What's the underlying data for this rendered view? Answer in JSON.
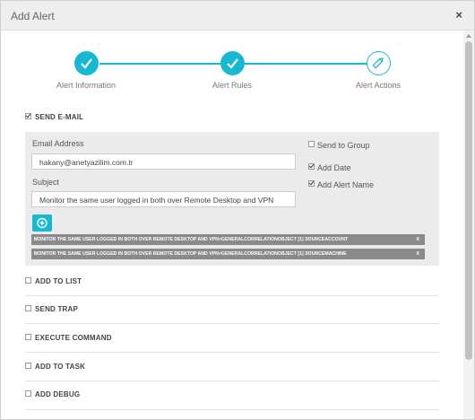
{
  "dialog": {
    "title": "Add Alert",
    "close_glyph": "×"
  },
  "wizard": {
    "steps": [
      {
        "label": "Alert Information",
        "state": "done",
        "icon": "check-icon"
      },
      {
        "label": "Alert Rules",
        "state": "done",
        "icon": "check-icon"
      },
      {
        "label": "Alert Actions",
        "state": "active",
        "icon": "pencil-icon"
      }
    ],
    "accent_color": "#17b9d2"
  },
  "send_email": {
    "label": "SEND E-MAIL",
    "checked": true,
    "email_label": "Email Address",
    "email_value": "hakany@anetyazilim.com.tr",
    "subject_label": "Subject",
    "subject_value": "Monitor the same user logged in both over Remote Desktop and VPN",
    "send_to_group": {
      "label": "Send to Group",
      "checked": false
    },
    "add_date": {
      "label": "Add Date",
      "checked": true
    },
    "add_alert_name": {
      "label": "Add Alert Name",
      "checked": true
    },
    "tags": [
      {
        "text": "MONITOR THE SAME USER LOGGED IN BOTH OVER REMOTE DESKTOP AND VPN>GENERALCORRELATIONOBJECT [1] SOURCEACCOUNT",
        "remove": "X"
      },
      {
        "text": "MONITOR THE SAME USER LOGGED IN BOTH OVER REMOTE DESKTOP AND VPN>GENERALCORRELATIONOBJECT [1] SOURCEMACHINE",
        "remove": "X"
      }
    ]
  },
  "options": [
    {
      "label": "ADD TO LIST",
      "checked": false
    },
    {
      "label": "SEND TRAP",
      "checked": false
    },
    {
      "label": "EXECUTE COMMAND",
      "checked": false
    },
    {
      "label": "ADD TO TASK",
      "checked": false
    },
    {
      "label": "ADD DEBUG",
      "checked": false
    }
  ]
}
